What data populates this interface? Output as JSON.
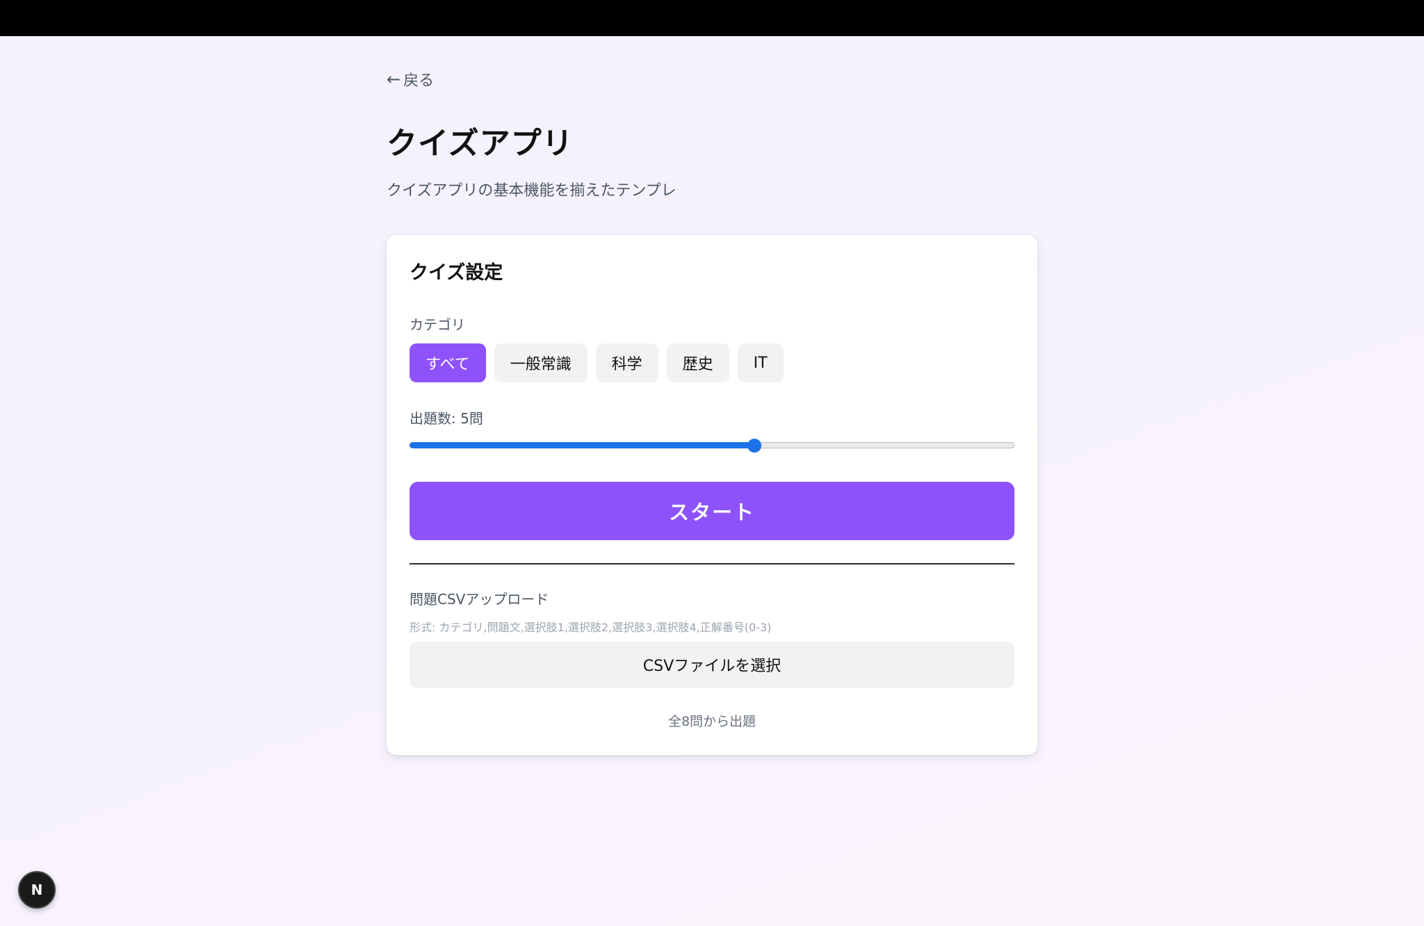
{
  "nav": {
    "back_arrow": "←",
    "back_label": "戻る"
  },
  "page": {
    "title": "クイズアプリ",
    "subtitle": "クイズアプリの基本機能を揃えたテンプレ"
  },
  "settings": {
    "title": "クイズ設定",
    "category_label": "カテゴリ",
    "categories": [
      {
        "label": "すべて",
        "selected": true
      },
      {
        "label": "一般常識",
        "selected": false
      },
      {
        "label": "科学",
        "selected": false
      },
      {
        "label": "歴史",
        "selected": false
      },
      {
        "label": "IT",
        "selected": false
      }
    ],
    "count_label": "出題数: 5問",
    "count_slider": {
      "value": 5,
      "fraction": 0.57
    },
    "start_label": "スタート",
    "csv_label": "問題CSVアップロード",
    "csv_format": "形式: カテゴリ,問題文,選択肢1,選択肢2,選択肢3,選択肢4,正解番号(0-3)",
    "csv_button_label": "CSVファイルを選択",
    "total_text": "全8問から出題"
  },
  "dev_badge": {
    "icon": "nextjs-icon",
    "letter": "N"
  },
  "colors": {
    "accent": "#8e52fb",
    "slider": "#1a73e8",
    "topbar": "#000000"
  }
}
